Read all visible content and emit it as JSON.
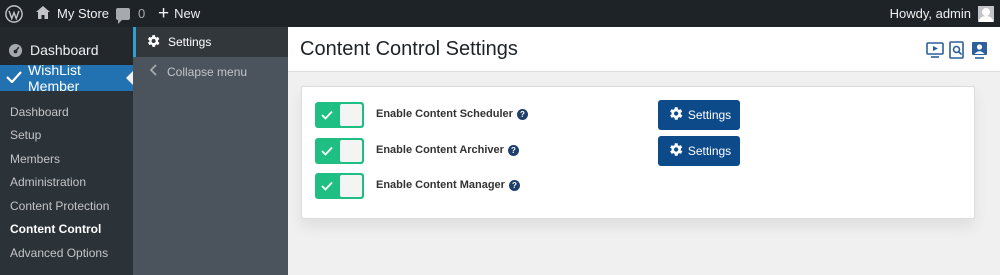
{
  "admin_bar": {
    "site_name": "My Store",
    "comments_count": "0",
    "new_label": "New",
    "howdy": "Howdy, admin"
  },
  "admin_menu": {
    "dashboard": "Dashboard",
    "wishlist": "WishList Member",
    "submenu": [
      {
        "label": "Dashboard"
      },
      {
        "label": "Setup"
      },
      {
        "label": "Members"
      },
      {
        "label": "Administration"
      },
      {
        "label": "Content Protection"
      },
      {
        "label": "Content Control"
      },
      {
        "label": "Advanced Options"
      }
    ]
  },
  "flyout": {
    "settings": "Settings",
    "collapse": "Collapse menu"
  },
  "main": {
    "title": "Content Control Settings",
    "rows": [
      {
        "label": "Enable Content Scheduler",
        "enabled": true,
        "button": "Settings"
      },
      {
        "label": "Enable Content Archiver",
        "enabled": true,
        "button": "Settings"
      },
      {
        "label": "Enable Content Manager",
        "enabled": true
      }
    ]
  },
  "icons": {
    "wordpress": "wordpress-logo-icon",
    "home": "home-icon",
    "comments": "comment-icon",
    "new": "plus-icon",
    "user": "user-avatar-icon",
    "gear": "gear-icon",
    "video": "video-icon",
    "search": "search-doc-icon",
    "profile": "user-profile-icon"
  },
  "colors": {
    "admin_bar": "#1d2327",
    "menu_active": "#2271b1",
    "toggle_on": "#1fbf84",
    "button": "#0d4a8a"
  }
}
